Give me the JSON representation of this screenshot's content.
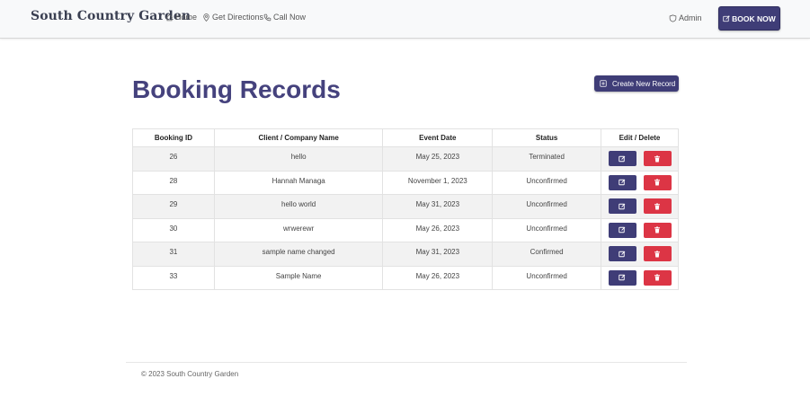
{
  "navbar": {
    "brand": "South Country Garden",
    "links": [
      {
        "label": "Home",
        "icon": "home-icon"
      },
      {
        "label": "Get Directions",
        "icon": "map-pin-icon"
      },
      {
        "label": "Call Now",
        "icon": "phone-icon"
      }
    ],
    "admin_label": "Admin",
    "admin_icon": "shield-icon",
    "book_label": "BOOK NOW",
    "book_icon": "edit-icon"
  },
  "main": {
    "title": "Booking Records",
    "create_label": "Create New Record",
    "create_icon": "plus-square-icon"
  },
  "table": {
    "headers": [
      "Booking ID",
      "Client / Company Name",
      "Event Date",
      "Status",
      "Edit / Delete"
    ],
    "rows": [
      {
        "id": "26",
        "name": "hello",
        "date": "May 25, 2023",
        "status": "Terminated"
      },
      {
        "id": "28",
        "name": "Hannah Managa",
        "date": "November 1, 2023",
        "status": "Unconfirmed"
      },
      {
        "id": "29",
        "name": "hello world",
        "date": "May 31, 2023",
        "status": "Unconfirmed"
      },
      {
        "id": "30",
        "name": "wrwerewr",
        "date": "May 26, 2023",
        "status": "Unconfirmed"
      },
      {
        "id": "31",
        "name": "sample name changed",
        "date": "May 31, 2023",
        "status": "Confirmed"
      },
      {
        "id": "33",
        "name": "Sample Name",
        "date": "May 26, 2023",
        "status": "Unconfirmed"
      }
    ]
  },
  "footer": {
    "copyright": "© 2023 South Country Garden"
  },
  "colors": {
    "primary": "#3f3d77",
    "title": "#45427d",
    "danger": "#dc3545",
    "row_stripe": "#f2f2f2"
  }
}
